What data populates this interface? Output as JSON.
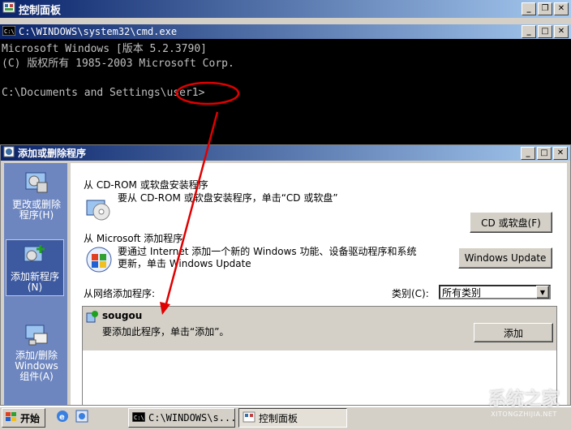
{
  "control_panel": {
    "title": "控制面板"
  },
  "cmd": {
    "title": "C:\\WINDOWS\\system32\\cmd.exe",
    "lines": [
      "Microsoft Windows [版本 5.2.3790]",
      "(C) 版权所有 1985-2003 Microsoft Corp.",
      "",
      "C:\\Documents and Settings\\user1>"
    ]
  },
  "dialog": {
    "title": "添加或删除程序",
    "sidebar": [
      {
        "label": "更改或删除程序(H)"
      },
      {
        "label": "添加新程序(N)"
      },
      {
        "label": "添加/删除Windows组件(A)"
      }
    ],
    "cdrom": {
      "title": "从 CD-ROM 或软盘安装程序",
      "desc": "要从 CD-ROM 或软盘安装程序，单击“CD 或软盘”",
      "button": "CD 或软盘(F)"
    },
    "microsoft": {
      "title": "从 Microsoft 添加程序",
      "desc_line1": "要通过 Internet 添加一个新的 Windows 功能、设备驱动程序和系统",
      "desc_line2": "更新，单击 Windows Update",
      "button": "Windows Update"
    },
    "network": {
      "title": "从网络添加程序:",
      "category_label": "类别(C):",
      "category_value": "所有类别"
    },
    "program": {
      "name": "sougou",
      "desc": "要添加此程序，单击“添加”。",
      "button": "添加"
    }
  },
  "taskbar": {
    "start": "开始",
    "items": [
      {
        "label": "C:\\WINDOWS\\s..."
      },
      {
        "label": "控制面板"
      }
    ]
  },
  "watermark": {
    "text": "系统之家",
    "url": "XITONGZHIJIA.NET"
  },
  "colors": {
    "title_active": "#0a246a",
    "title_gradient": "#a6caf0",
    "highlight_red": "#e00000",
    "dialog_sidebar": "#6d86c0"
  }
}
